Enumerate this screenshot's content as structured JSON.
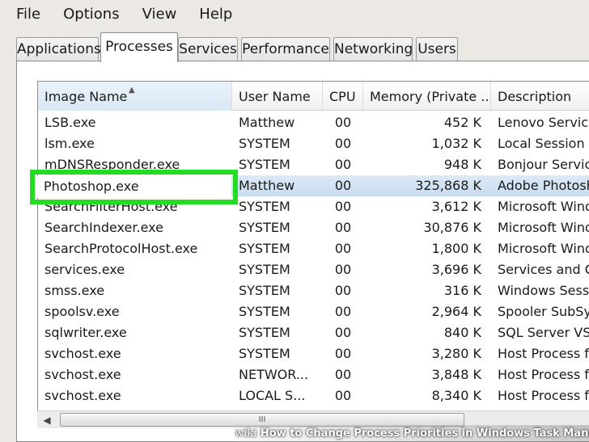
{
  "menu": [
    "File",
    "Options",
    "View",
    "Help"
  ],
  "tabs": [
    {
      "label": "Applications",
      "active": false
    },
    {
      "label": "Processes",
      "active": true
    },
    {
      "label": "Services",
      "active": false
    },
    {
      "label": "Performance",
      "active": false
    },
    {
      "label": "Networking",
      "active": false
    },
    {
      "label": "Users",
      "active": false
    }
  ],
  "columns": [
    "Image Name",
    "User Name",
    "CPU",
    "Memory (Private ...",
    "Description"
  ],
  "sort_indicator": "▲",
  "rows": [
    {
      "image": "LSB.exe",
      "user": "Matthew",
      "cpu": "00",
      "memory": "452 K",
      "description": "Lenovo Service"
    },
    {
      "image": "lsm.exe",
      "user": "SYSTEM",
      "cpu": "00",
      "memory": "1,032 K",
      "description": "Local Session M"
    },
    {
      "image": "mDNSResponder.exe",
      "user": "SYSTEM",
      "cpu": "00",
      "memory": "948 K",
      "description": "Bonjour Service"
    },
    {
      "image": "Photoshop.exe",
      "user": "Matthew",
      "cpu": "00",
      "memory": "325,868 K",
      "description": "Adobe Photosh",
      "selected": true
    },
    {
      "image": "SearchFilterHost.exe",
      "user": "SYSTEM",
      "cpu": "00",
      "memory": "3,612 K",
      "description": "Microsoft Windo"
    },
    {
      "image": "SearchIndexer.exe",
      "user": "SYSTEM",
      "cpu": "00",
      "memory": "30,876 K",
      "description": "Microsoft Windo"
    },
    {
      "image": "SearchProtocolHost.exe",
      "user": "SYSTEM",
      "cpu": "00",
      "memory": "1,800 K",
      "description": "Microsoft Windo"
    },
    {
      "image": "services.exe",
      "user": "SYSTEM",
      "cpu": "00",
      "memory": "3,696 K",
      "description": "Services and Co"
    },
    {
      "image": "smss.exe",
      "user": "SYSTEM",
      "cpu": "00",
      "memory": "316 K",
      "description": "Windows Sessio"
    },
    {
      "image": "spoolsv.exe",
      "user": "SYSTEM",
      "cpu": "00",
      "memory": "2,964 K",
      "description": "Spooler SubSys"
    },
    {
      "image": "sqlwriter.exe",
      "user": "SYSTEM",
      "cpu": "00",
      "memory": "840 K",
      "description": "SQL Server VSS"
    },
    {
      "image": "svchost.exe",
      "user": "SYSTEM",
      "cpu": "00",
      "memory": "3,280 K",
      "description": "Host Process fo"
    },
    {
      "image": "svchost.exe",
      "user": "NETWOR...",
      "cpu": "00",
      "memory": "3,848 K",
      "description": "Host Process fo"
    },
    {
      "image": "svchost.exe",
      "user": "LOCAL S...",
      "cpu": "00",
      "memory": "8,340 K",
      "description": "Host Process fo"
    }
  ],
  "scroll": {
    "left_arrow": "◀",
    "thumb_grip": "III"
  },
  "watermark": {
    "brand": "wiki",
    "text": "How to Change Process Priorities in Windows Task Manager"
  },
  "colors": {
    "highlight": "#22dd22",
    "selection": "#c8dcef"
  }
}
